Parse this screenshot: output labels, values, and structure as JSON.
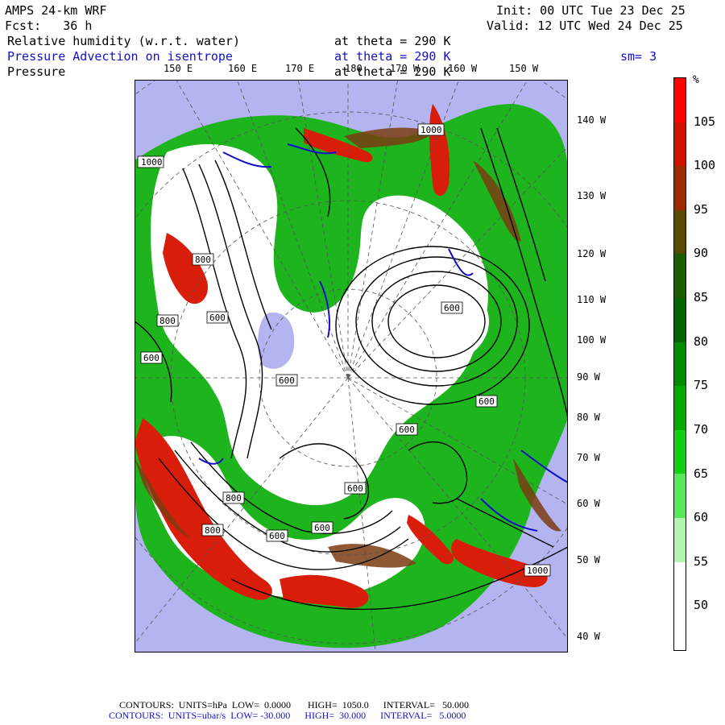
{
  "header": {
    "model": "AMPS 24-km WRF",
    "init": "Init: 00 UTC Tue 23 Dec 25",
    "forecast": "Fcst:   36 h",
    "valid": "Valid: 12 UTC Wed 24 Dec 25"
  },
  "fields": [
    {
      "name": "Relative humidity (w.r.t. water)",
      "level": "at theta = 290 K",
      "color": "#000000"
    },
    {
      "name": "Pressure Advection on isentrope",
      "level": "at theta = 290 K",
      "color": "#1010c8",
      "extra": "sm= 3"
    },
    {
      "name": "Pressure",
      "level": "at theta = 290 K",
      "color": "#000000"
    }
  ],
  "longitude_labels": [
    "150 E",
    "160 E",
    "170 E",
    "180",
    "170 W",
    "160 W",
    "150 W"
  ],
  "latitude_side_labels": [
    "140 W",
    "130 W",
    "120 W",
    "110 W",
    "100 W",
    "90 W",
    "80 W",
    "70 W",
    "60 W",
    "50 W",
    "40 W"
  ],
  "contour_labels": [
    "1000",
    "800",
    "800",
    "800",
    "600",
    "600",
    "600",
    "600",
    "600",
    "600",
    "600",
    "600",
    "600",
    "600",
    "800",
    "800",
    "1000",
    "1000"
  ],
  "colorbar": {
    "unit": "%",
    "labels": [
      "105",
      "100",
      "95",
      "90",
      "85",
      "80",
      "75",
      "70",
      "65",
      "60",
      "55",
      "50"
    ],
    "colors": [
      "#ff0000",
      "#d01000",
      "#9c2a00",
      "#5a4a00",
      "#1e5a00",
      "#006400",
      "#008c00",
      "#00aa00",
      "#14d014",
      "#5ae65a",
      "#b4f5b4",
      "#ffffff",
      "#ffffff"
    ]
  },
  "footer": {
    "line1": "CONTOURS:  UNITS=hPa  LOW=  0.0000       HIGH=  1050.0      INTERVAL=   50.000",
    "line2": "CONTOURS:  UNITS=ubar/s  LOW= -30.000      HIGH=  30.000      INTERVAL=   5.0000"
  },
  "map_colors": {
    "ocean_dry": "#b4b4f0",
    "humid_green": "#1eb41e",
    "very_humid_red": "#d81e0a",
    "brown": "#7a3c10",
    "contour": "#000000",
    "advection": "#1010c8"
  }
}
